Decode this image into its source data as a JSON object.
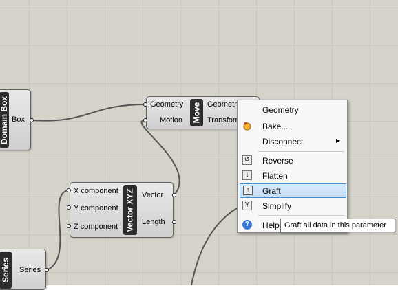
{
  "canvas": {
    "background_color": "#d6d3cb",
    "grid_color": "#c9c6be",
    "wire_color": "#555555"
  },
  "components": {
    "domain_box": {
      "nickname": "Domain Box",
      "outputs": [
        "Box"
      ]
    },
    "move": {
      "nickname": "Move",
      "inputs": [
        "Geometry",
        "Motion"
      ],
      "outputs": [
        "Geometry",
        "Transform"
      ]
    },
    "vector_xyz": {
      "nickname": "Vector XYZ",
      "inputs": [
        "X component",
        "Y component",
        "Z component"
      ],
      "outputs": [
        "Vector",
        "Length"
      ]
    },
    "series": {
      "nickname": "Series",
      "outputs": [
        "Series"
      ]
    }
  },
  "context_menu": {
    "title": "Geometry",
    "items": [
      {
        "label": "Bake...",
        "icon": "bake-icon"
      },
      {
        "label": "Disconnect",
        "icon": "none",
        "submenu": true
      },
      {
        "label": "Reverse",
        "icon": "reverse-icon"
      },
      {
        "label": "Flatten",
        "icon": "flatten-icon"
      },
      {
        "label": "Graft",
        "icon": "graft-icon",
        "highlighted": true
      },
      {
        "label": "Simplify",
        "icon": "simplify-icon"
      },
      {
        "label": "Help",
        "icon": "help-icon"
      }
    ],
    "submenu_arrow": "▶",
    "highlight_color": "#c1ddf8",
    "highlight_border": "#3c8fd6"
  },
  "tooltip": {
    "text": "Graft all data in this parameter"
  }
}
